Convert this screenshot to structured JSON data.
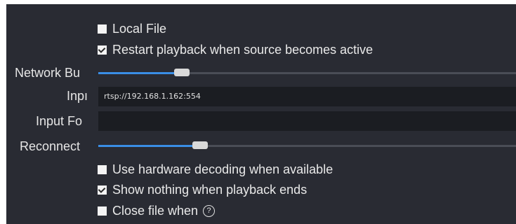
{
  "options": {
    "local_file": {
      "label": "Local File",
      "checked": false
    },
    "restart_playback": {
      "label": "Restart playback when source becomes active",
      "checked": true
    },
    "hw_decoding": {
      "label": "Use hardware decoding when available",
      "checked": false
    },
    "show_nothing": {
      "label": "Show nothing when playback ends",
      "checked": true
    },
    "close_file": {
      "label": "Close file when",
      "checked": false,
      "help_glyph": "?"
    }
  },
  "network_buffering": {
    "label": "Network Bu",
    "value_fraction": 0.17
  },
  "input": {
    "label": "Inpı",
    "value": "rtsp://192.168.1.162:554"
  },
  "input_format": {
    "label": "Input Fo",
    "value": ""
  },
  "reconnect": {
    "label": "Reconnect",
    "value_fraction": 0.21
  },
  "colors": {
    "panel_bg": "#292b33",
    "accent": "#3a8ee6",
    "field_bg": "#1b1d22"
  }
}
